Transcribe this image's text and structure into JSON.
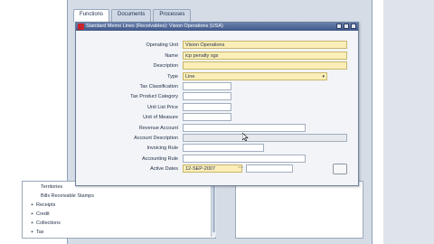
{
  "navigator": {
    "tabs": [
      "Functions",
      "Documents",
      "Processes"
    ],
    "tree": [
      {
        "label": "Territories",
        "bullet": ""
      },
      {
        "label": "Bills Receivable Stamps",
        "bullet": ""
      },
      {
        "label": "Receipts",
        "bullet": "+"
      },
      {
        "label": "Credit",
        "bullet": "+"
      },
      {
        "label": "Collections",
        "bullet": "+"
      },
      {
        "label": "Tax",
        "bullet": "+"
      }
    ]
  },
  "dialog": {
    "title": "Standard Memo Lines (Receivables): Vision Operations (USA)",
    "fields": {
      "operating_unit": {
        "label": "Operating Unit",
        "value": "Vision Operations"
      },
      "name": {
        "label": "Name",
        "value": "icp penalty sgs"
      },
      "description": {
        "label": "Description",
        "value": ""
      },
      "type": {
        "label": "Type",
        "value": "Line"
      },
      "tax_classification": {
        "label": "Tax Classification",
        "value": ""
      },
      "tax_product_category": {
        "label": "Tax Product Category",
        "value": ""
      },
      "unit_list_price": {
        "label": "Unit List Price",
        "value": ""
      },
      "unit_of_measure": {
        "label": "Unit of Measure",
        "value": ""
      },
      "revenue_account": {
        "label": "Revenue Account",
        "value": ""
      },
      "account_description": {
        "label": "Account Description",
        "value": ""
      },
      "invoicing_rule": {
        "label": "Invoicing Rule",
        "value": ""
      },
      "accounting_rule": {
        "label": "Accounting Rule",
        "value": ""
      },
      "active_dates": {
        "label": "Active Dates",
        "from": "12-SEP-2007",
        "to": ""
      }
    }
  }
}
